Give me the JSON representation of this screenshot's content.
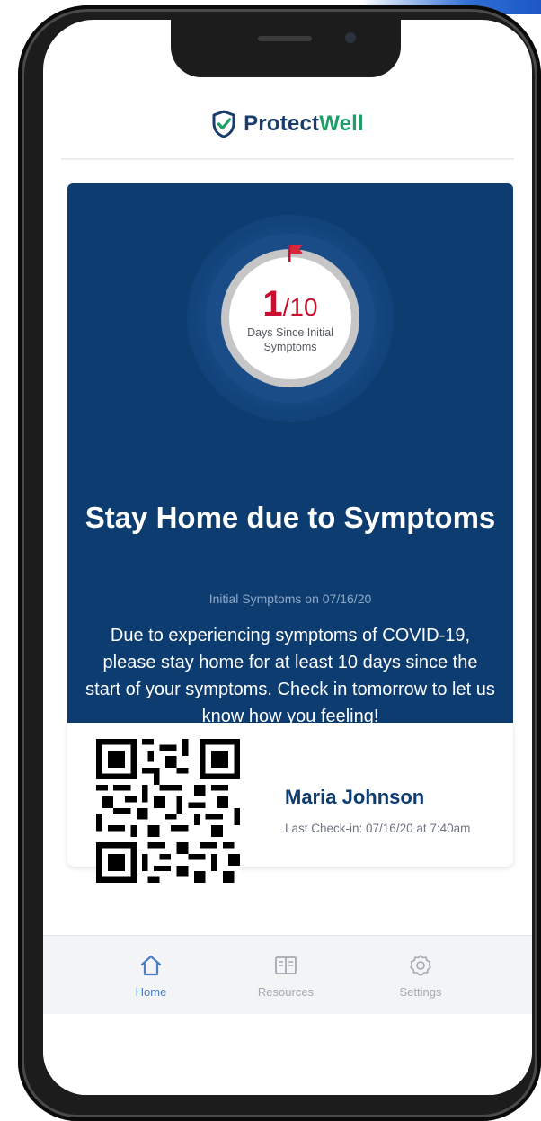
{
  "app": {
    "brand_part1": "Protect",
    "brand_part2": "Well",
    "brand_color_dark": "#1b3d6e",
    "brand_color_green": "#1f9e6a",
    "logo_icon": "shield-check-icon"
  },
  "status_card": {
    "background": "#0c3c70",
    "accent": "#c8102e",
    "day_count": "1",
    "day_total": "/10",
    "progress": {
      "current": 1,
      "total": 10
    },
    "ring_caption": "Days Since Initial Symptoms",
    "flag_icon": "flag-icon",
    "title": "Stay Home due to Symptoms",
    "subtitle": "Initial Symptoms on 07/16/20",
    "body": "Due to experiencing symptoms of COVID-19, please stay home for at least 10 days since the start of your symptoms. Check in tomorrow to let us know how you feeling!"
  },
  "user_card": {
    "qr_icon": "qr-code-icon",
    "name": "Maria Johnson",
    "last_checkin": "Last Check-in: 07/16/20 at 7:40am"
  },
  "tabs": [
    {
      "label": "Home",
      "icon": "home-icon",
      "active": true
    },
    {
      "label": "Resources",
      "icon": "book-icon",
      "active": false
    },
    {
      "label": "Settings",
      "icon": "gear-icon",
      "active": false
    }
  ]
}
